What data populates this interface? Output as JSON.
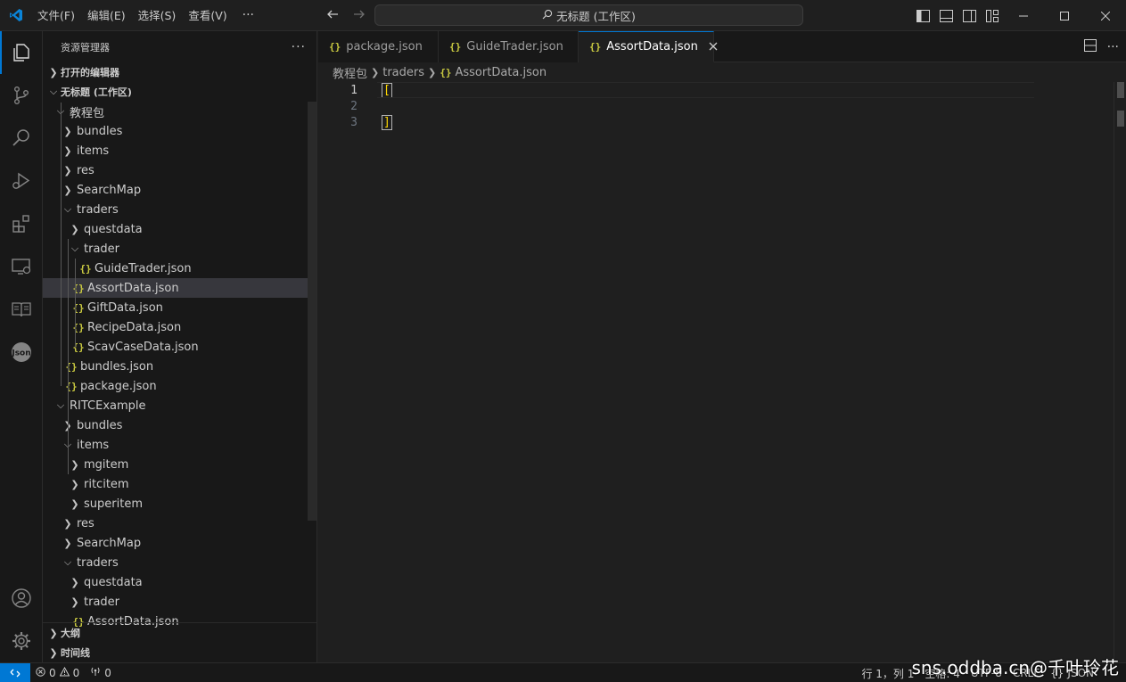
{
  "menu": {
    "items": [
      "文件(F)",
      "编辑(E)",
      "选择(S)",
      "查看(V)"
    ],
    "more": "···"
  },
  "search": {
    "label": "无标题 (工作区)"
  },
  "sidebar": {
    "title": "资源管理器",
    "more": "···",
    "open_editors": "打开的编辑器",
    "workspace": "无标题 (工作区)",
    "tree": [
      {
        "label": "教程包",
        "type": "folder-open"
      },
      {
        "label": "bundles",
        "type": "folder"
      },
      {
        "label": "items",
        "type": "folder"
      },
      {
        "label": "res",
        "type": "folder"
      },
      {
        "label": "SearchMap",
        "type": "folder"
      },
      {
        "label": "traders",
        "type": "folder-open"
      },
      {
        "label": "questdata",
        "type": "folder"
      },
      {
        "label": "trader",
        "type": "folder-open"
      },
      {
        "label": "GuideTrader.json",
        "type": "file"
      },
      {
        "label": "AssortData.json",
        "type": "file"
      },
      {
        "label": "GiftData.json",
        "type": "file"
      },
      {
        "label": "RecipeData.json",
        "type": "file"
      },
      {
        "label": "ScavCaseData.json",
        "type": "file"
      },
      {
        "label": "bundles.json",
        "type": "file"
      },
      {
        "label": "package.json",
        "type": "file"
      },
      {
        "label": "RITCExample",
        "type": "folder-open"
      },
      {
        "label": "bundles",
        "type": "folder"
      },
      {
        "label": "items",
        "type": "folder-open"
      },
      {
        "label": "mgitem",
        "type": "folder"
      },
      {
        "label": "ritcitem",
        "type": "folder"
      },
      {
        "label": "superitem",
        "type": "folder"
      },
      {
        "label": "res",
        "type": "folder"
      },
      {
        "label": "SearchMap",
        "type": "folder"
      },
      {
        "label": "traders",
        "type": "folder-open"
      },
      {
        "label": "questdata",
        "type": "folder"
      },
      {
        "label": "trader",
        "type": "folder"
      },
      {
        "label": "AssortData.json",
        "type": "file"
      }
    ],
    "outline": "大纲",
    "timeline": "时间线"
  },
  "tabs": [
    {
      "label": "package.json"
    },
    {
      "label": "GuideTrader.json"
    },
    {
      "label": "AssortData.json"
    }
  ],
  "breadcrumb": {
    "root": "教程包",
    "folder": "traders",
    "file": "AssortData.json"
  },
  "code": {
    "lines": [
      {
        "number": "1",
        "text": "["
      },
      {
        "number": "2",
        "text": ""
      },
      {
        "number": "3",
        "text": "]"
      }
    ]
  },
  "status": {
    "errors": "0",
    "warnings": "0",
    "ports": "0",
    "position": "行 1，列 1",
    "spaces": "空格: 4",
    "encoding": "UTF-8",
    "eol": "CRLF",
    "language": "JSON"
  },
  "watermark": "sns.oddba.cn@千叶玲花",
  "colors": {
    "accent": "#0078d4",
    "json_icon": "#cbcb41",
    "bracket": "#ffd700"
  }
}
